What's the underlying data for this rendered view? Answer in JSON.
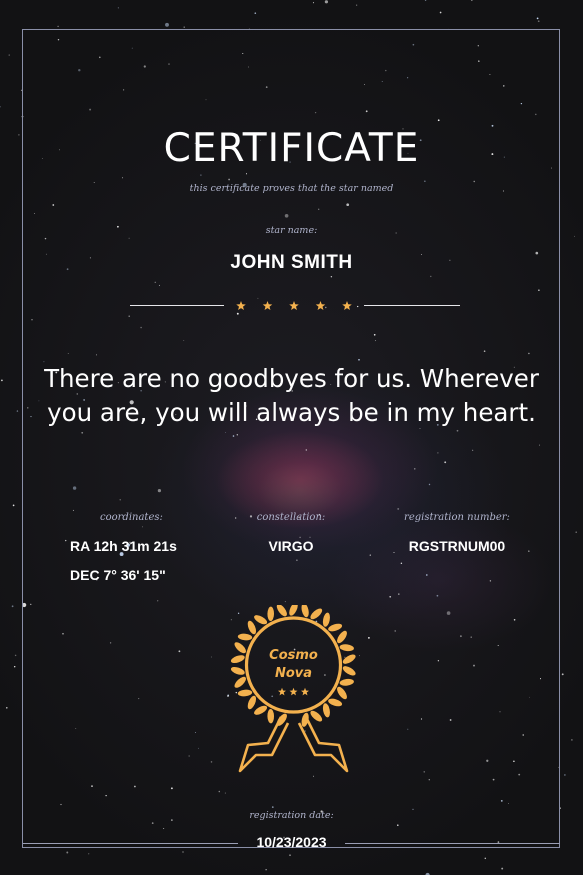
{
  "certificate": {
    "title": "CERTIFICATE",
    "subtitle": "this certificate proves that the star named",
    "star_name_label": "star name:",
    "star_name": "JOHN SMITH",
    "rating_stars": 5,
    "message_line1": "There are no goodbyes for us. Wherever",
    "message_line2": "you are, you will always be in my heart."
  },
  "details": {
    "coordinates_label": "coordinates:",
    "ra": "RA 12h 31m 21s",
    "dec": "DEC 7° 36' 15\"",
    "constellation_label": "constellation:",
    "constellation": "VIRGO",
    "registration_label": "registration number:",
    "registration_number": "RGSTRNUM00"
  },
  "seal": {
    "line1": "Cosmo",
    "line2": "Nova"
  },
  "footer": {
    "date_label": "registration date:",
    "date": "10/23/2023"
  },
  "colors": {
    "accent": "#f3b14e",
    "background": "#141416",
    "frame": "#8a8fa8",
    "muted_text": "#b0b4cc"
  }
}
